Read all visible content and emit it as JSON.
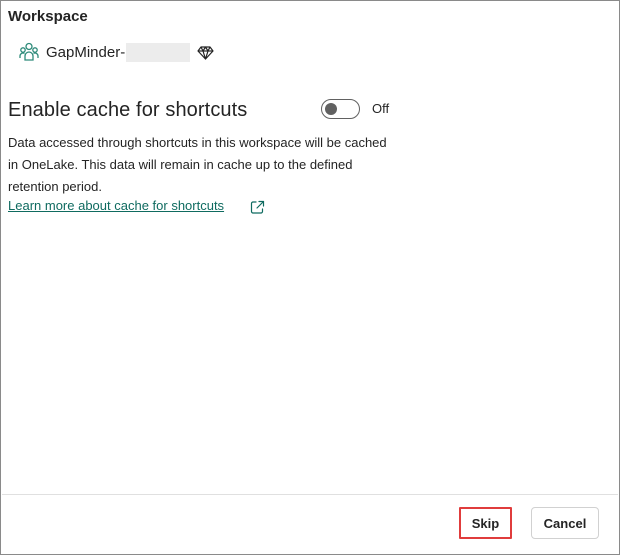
{
  "workspace": {
    "section_title": "Workspace",
    "name": "GapMinder-",
    "icon": "workspace-people-icon",
    "badge_icon": "premium-diamond-icon"
  },
  "cache": {
    "title": "Enable cache for shortcuts",
    "toggle_state": "Off",
    "description": "Data accessed through shortcuts in this workspace will be cached in OneLake. This data will remain in cache up to the defined retention period.",
    "learn_more_label": "Learn more about cache for shortcuts",
    "learn_more_icon": "open-external-icon",
    "link_color": "#0f6b60"
  },
  "footer": {
    "skip_label": "Skip",
    "cancel_label": "Cancel",
    "highlight_color": "#e03c3c"
  }
}
